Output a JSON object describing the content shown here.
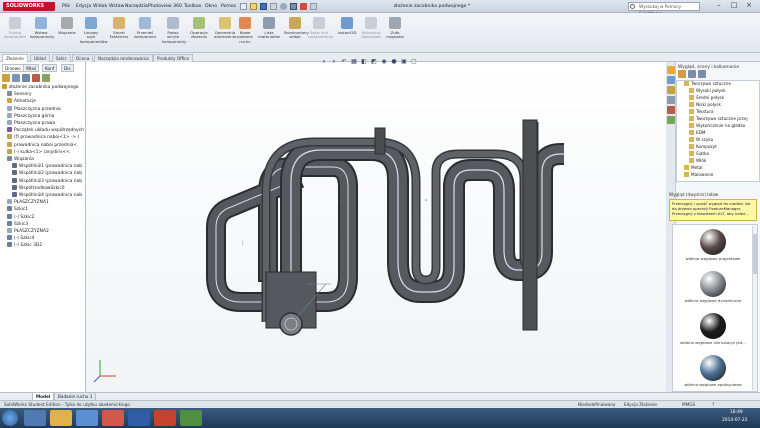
{
  "app": {
    "logo": "SOLIDWORKS",
    "doc_title": "złożenie zacobnika podwojnego *",
    "help_search_placeholder": "Wyszukaj w Pomocy SolidWorks",
    "win_min": "–",
    "win_max": "□",
    "win_close": "×"
  },
  "menu": [
    "Plik",
    "Edycja",
    "Widok",
    "Wstaw",
    "Narzędzia",
    "Photoview 360",
    "Toolbox",
    "Okno",
    "Pomoc"
  ],
  "ribbon": {
    "buttons": [
      {
        "label": "Edytuj komponent",
        "disabled": true,
        "color": "#c9ced6"
      },
      {
        "label": "Wstaw komponenty",
        "disabled": false,
        "color": "#8fb3db"
      },
      {
        "label": "Wiązanie",
        "disabled": false,
        "color": "#a7a9ad"
      },
      {
        "label": "Liniowy szyk komponentów",
        "disabled": false,
        "color": "#7ea7d1"
      },
      {
        "label": "Smart Fasteners",
        "disabled": false,
        "color": "#d9b36b"
      },
      {
        "label": "Przenieś komponent",
        "disabled": false,
        "color": "#9fb9d6"
      },
      {
        "label": "Pokaż ukryte komponenty",
        "disabled": false,
        "color": "#b0bccb"
      },
      {
        "label": "Operacje złożenia",
        "disabled": false,
        "color": "#a6c07a"
      },
      {
        "label": "Geometria odniesienia",
        "disabled": false,
        "color": "#d9c36b"
      },
      {
        "label": "Nowe badanie ruchu",
        "disabled": false,
        "color": "#e08a4f"
      },
      {
        "label": "Lista materiałów",
        "disabled": false,
        "color": "#8f9cb0"
      },
      {
        "label": "Rozstrzelony widok",
        "disabled": false,
        "color": "#c9a75a"
      },
      {
        "label": "Szkic linii rozstrzelenia",
        "disabled": true,
        "color": "#c9ced6"
      },
      {
        "label": "Instant3D",
        "disabled": false,
        "color": "#6f9bd0"
      },
      {
        "label": "Aktualizuj Speedpak",
        "disabled": true,
        "color": "#c9ced6"
      },
      {
        "label": "Zrób migawkę",
        "disabled": false,
        "color": "#a0a7b3"
      }
    ]
  },
  "tabs": [
    "Złożenie",
    "Układ",
    "Szkic",
    "Ocena",
    "Narzędzia renderowania",
    "Produkty Office"
  ],
  "left_panel": {
    "tabs": [
      "Drzewo",
      "Właś",
      "Konf",
      "Dis"
    ],
    "tree": [
      {
        "label": "złożenie zacobnika podwojnego",
        "indent": 0,
        "color": "#c49a35"
      },
      {
        "label": "Sensory",
        "indent": 1,
        "color": "#7c8aa0"
      },
      {
        "label": "Adnotacje",
        "indent": 1,
        "color": "#d8a436"
      },
      {
        "label": "Płaszczyzna przednia",
        "indent": 1,
        "color": "#9aa8bd"
      },
      {
        "label": "Płaszczyzna górna",
        "indent": 1,
        "color": "#9aa8bd"
      },
      {
        "label": "Płaszczyzna prawa",
        "indent": 1,
        "color": "#9aa8bd"
      },
      {
        "label": "Początek układu współrzędnych",
        "indent": 1,
        "color": "#7b5aa0"
      },
      {
        "label": "(f) prowadnica naboi<1> -> (",
        "indent": 1,
        "color": "#c7a347"
      },
      {
        "label": "prowadnica naboi przednia<",
        "indent": 1,
        "color": "#c7a347"
      },
      {
        "label": "(-) kulka<1> (anydiris<<",
        "indent": 1,
        "color": "#c7a347"
      },
      {
        "label": "Wiązania",
        "indent": 1,
        "color": "#7c8aa0"
      },
      {
        "label": "Współliniż1 (prowadnica nab",
        "indent": 2,
        "color": "#5a6c86"
      },
      {
        "label": "Współliniż2 (prowadnica nab",
        "indent": 2,
        "color": "#5a6c86"
      },
      {
        "label": "Współliniż3 (prowadnica nab",
        "indent": 2,
        "color": "#5a6c86"
      },
      {
        "label": "WspółśrodkowSzkic0",
        "indent": 2,
        "color": "#5a6c86"
      },
      {
        "label": "Współliniż4 (prowadnica nab",
        "indent": 2,
        "color": "#5a6c86"
      },
      {
        "label": "PŁASZCZYZNA1",
        "indent": 1,
        "color": "#9aa8bd"
      },
      {
        "label": "Szkic1",
        "indent": 1,
        "color": "#6b7f9e"
      },
      {
        "label": "(-) Szkic2",
        "indent": 1,
        "color": "#6b7f9e"
      },
      {
        "label": "Szkic3",
        "indent": 1,
        "color": "#6b7f9e"
      },
      {
        "label": "PŁASZCZYZNA2",
        "indent": 1,
        "color": "#9aa8bd"
      },
      {
        "label": "(-) Szkic4",
        "indent": 1,
        "color": "#6b7f9e"
      },
      {
        "label": "(-) Szkic 3D2",
        "indent": 1,
        "color": "#6b7f9e"
      }
    ]
  },
  "right_panel": {
    "title": "Wygląd, sceny i kalkomanie",
    "tree": [
      {
        "label": "Tworzywo sztuczne",
        "indent": 1,
        "color": "#d6b84c"
      },
      {
        "label": "Wysoki połysk",
        "indent": 2,
        "color": "#d6b84c"
      },
      {
        "label": "Średni połysk",
        "indent": 2,
        "color": "#d6b84c"
      },
      {
        "label": "Niski połysk",
        "indent": 2,
        "color": "#d6b84c"
      },
      {
        "label": "Tekstura",
        "indent": 2,
        "color": "#d6b84c"
      },
      {
        "label": "Tworzywo sztuczne przej",
        "indent": 2,
        "color": "#d6b84c"
      },
      {
        "label": "Wykończenie na gładko",
        "indent": 2,
        "color": "#d6b84c"
      },
      {
        "label": "EDM",
        "indent": 2,
        "color": "#d6b84c"
      },
      {
        "label": "W szyku",
        "indent": 2,
        "color": "#d6b84c"
      },
      {
        "label": "Kompozyt",
        "indent": 2,
        "color": "#d6b84c"
      },
      {
        "label": "Siatka",
        "indent": 2,
        "color": "#d6b84c"
      },
      {
        "label": "Włók",
        "indent": 2,
        "color": "#d6b84c"
      },
      {
        "label": "Metal",
        "indent": 1,
        "color": "#d6b84c"
      },
      {
        "label": "Malowanie",
        "indent": 1,
        "color": "#d6b84c"
      }
    ],
    "tip_title": "Wygląd (dwyslnz) łaław",
    "tip_text": "Przeciągnij i upuść wygląd do modelu lub do drzewa operacji FeatureManager. Przeciągnij z klawiszem ALT, aby należ...",
    "materials": [
      {
        "label": "włókno węglowe projektowe",
        "color": "#5a4a4a"
      },
      {
        "label": "włókno węglowe dynamiczne",
        "color": "#8a9096"
      },
      {
        "label": "włókno węglowe inkrustacje jed...",
        "color": "#1c1c1c"
      },
      {
        "label": "włókno węglowe epoksydowe",
        "color": "#4d6f96"
      }
    ]
  },
  "bottom_tabs": [
    "Model",
    "Badanie ruchu 1"
  ],
  "status": {
    "left": "SolidWorks Student Edition - Tylko do użytku akademickiego",
    "state1": "Niedodefiniowany",
    "state2": "Edycja Złożenie",
    "units": "MMGS",
    "help": "?"
  },
  "taskbar": {
    "time": "18:49",
    "date": "2014-07-22"
  },
  "colors": {
    "accent": "#c8102e",
    "part_fill": "#4d4f53",
    "part_stroke": "#2b2d30",
    "highlight": "#d8dee7"
  }
}
